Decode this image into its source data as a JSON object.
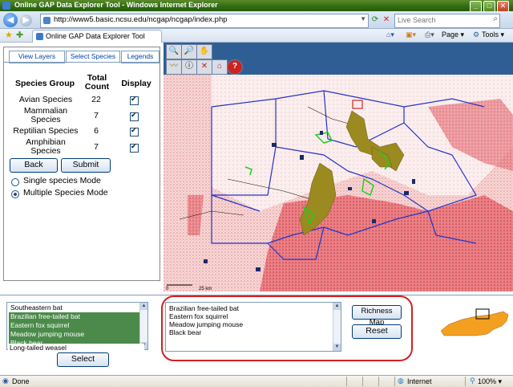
{
  "window": {
    "title": "Online GAP Data Explorer Tool - Windows Internet Explorer",
    "controls": [
      "_",
      "□",
      "✕"
    ]
  },
  "address_bar": {
    "url": "http://www5.basic.ncsu.edu/ncgap/ncgap/index.php",
    "search_placeholder": "Live Search"
  },
  "tab": {
    "label": "Online GAP Data Explorer Tool"
  },
  "command_bar": {
    "page_label": "Page ▾",
    "tools_label": "Tools ▾"
  },
  "left_panel": {
    "tabs": [
      "View Layers",
      "Select Species",
      "Legends"
    ],
    "active_tab": 1,
    "headers": {
      "group": "Species Group",
      "count": "Total\nCount",
      "display": "Display"
    },
    "rows": [
      {
        "group": "Avian Species",
        "count": "22",
        "display": true
      },
      {
        "group": "Mammalian Species",
        "count": "7",
        "display": true
      },
      {
        "group": "Reptilian Species",
        "count": "6",
        "display": true
      },
      {
        "group": "Amphibian Species",
        "count": "7",
        "display": true
      }
    ],
    "back_label": "Back",
    "submit_label": "Submit",
    "modes": [
      {
        "label": "Single species Mode",
        "selected": false
      },
      {
        "label": "Multiple Species Mode",
        "selected": true
      }
    ]
  },
  "map": {
    "scale_left": "0",
    "scale_right": "25 km"
  },
  "species_list": {
    "items": [
      {
        "name": "Southeastern bat",
        "selected": false
      },
      {
        "name": "Brazilian free-tailed bat",
        "selected": true
      },
      {
        "name": "Eastern fox squirrel",
        "selected": true
      },
      {
        "name": "Meadow jumping mouse",
        "selected": true
      },
      {
        "name": "Black bear",
        "selected": true
      },
      {
        "name": "Long-tailed weasel",
        "selected": false
      }
    ],
    "select_label": "Select"
  },
  "chosen_species": {
    "items": [
      "Brazilian free-tailed bat",
      "Eastern fox squirrel",
      "Meadow jumping mouse",
      "Black bear"
    ],
    "richness_label": "Richness Map",
    "reset_label": "Reset"
  },
  "status_bar": {
    "left": "Done",
    "zone": "Internet",
    "zoom": "100% ▾"
  },
  "colors": {
    "title_green": "#2f6a10",
    "map_toolbar": "#2f5e95",
    "selected_item": "#4b8a4b",
    "highlight_outline": "#d42020",
    "map_pink": "#f0b8b8",
    "map_red": "#e06a70",
    "boundary_blue": "#2233cc",
    "species_olive": "#9a8a20",
    "species_green": "#22cc22",
    "minimap_orange": "#f3a020"
  }
}
